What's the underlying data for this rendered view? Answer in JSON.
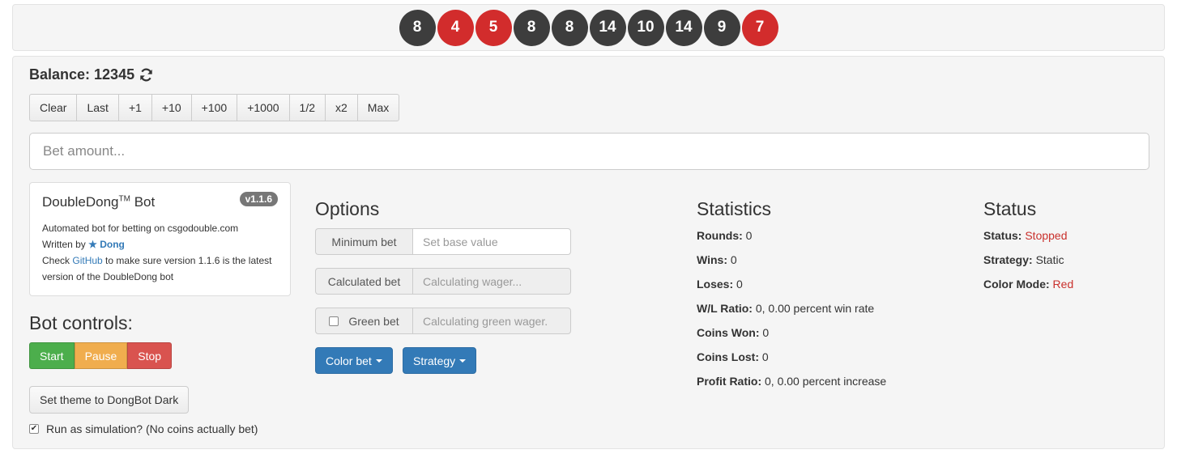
{
  "history": [
    {
      "value": "8",
      "color": "black"
    },
    {
      "value": "4",
      "color": "red"
    },
    {
      "value": "5",
      "color": "red"
    },
    {
      "value": "8",
      "color": "black"
    },
    {
      "value": "8",
      "color": "black"
    },
    {
      "value": "14",
      "color": "black"
    },
    {
      "value": "10",
      "color": "black"
    },
    {
      "value": "14",
      "color": "black"
    },
    {
      "value": "9",
      "color": "black"
    },
    {
      "value": "7",
      "color": "red"
    }
  ],
  "balance": {
    "label": "Balance: 12345",
    "icon": "refresh-icon"
  },
  "bet_buttons": [
    "Clear",
    "Last",
    "+1",
    "+10",
    "+100",
    "+1000",
    "1/2",
    "x2",
    "Max"
  ],
  "bet_input": {
    "placeholder": "Bet amount...",
    "value": ""
  },
  "info": {
    "title": "DoubleDong",
    "tm": "TM",
    "title_suffix": " Bot",
    "version": "v1.1.6",
    "line1": "Automated bot for betting on csgodouble.com",
    "written_by": "Written by ",
    "author": "★ Dong",
    "check": "Check ",
    "github": "GitHub",
    "check_rest": " to make sure version 1.1.6 is the latest",
    "line4": "version of the DoubleDong bot"
  },
  "controls": {
    "title": "Bot controls:",
    "start": "Start",
    "pause": "Pause",
    "stop": "Stop",
    "theme": "Set theme to DongBot Dark",
    "simulation": "Run as simulation? (No coins actually bet)",
    "simulation_checked": true
  },
  "options": {
    "title": "Options",
    "min_bet_label": "Minimum bet",
    "min_bet_placeholder": "Set base value",
    "calc_bet_label": "Calculated bet",
    "calc_bet_placeholder": "Calculating wager...",
    "green_bet_label": "Green bet",
    "green_bet_placeholder": "Calculating green wager.",
    "color_bet": "Color bet",
    "strategy": "Strategy"
  },
  "statistics": {
    "title": "Statistics",
    "rows": [
      {
        "label": "Rounds:",
        "value": " 0"
      },
      {
        "label": "Wins:",
        "value": " 0"
      },
      {
        "label": "Loses:",
        "value": " 0"
      },
      {
        "label": "W/L Ratio:",
        "value": " 0, 0.00 percent win rate"
      },
      {
        "label": "Coins Won:",
        "value": " 0"
      },
      {
        "label": "Coins Lost:",
        "value": " 0"
      },
      {
        "label": "Profit Ratio:",
        "value": " 0, 0.00 percent increase"
      }
    ]
  },
  "status": {
    "title": "Status",
    "status_label": "Status:",
    "status_value": "Stopped",
    "strategy_label": "Strategy:",
    "strategy_value": " Static",
    "color_label": "Color Mode:",
    "color_value": "Red"
  },
  "colors": {
    "red": "#d22c2c",
    "black": "#3d3d3d",
    "primary": "#337ab7",
    "success": "#4cae4c",
    "warning": "#f0ad4e",
    "danger": "#d9534f"
  }
}
